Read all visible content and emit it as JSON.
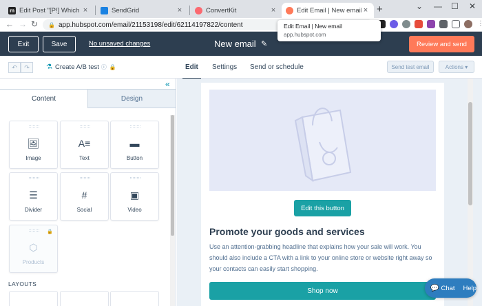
{
  "browser": {
    "tabs": [
      {
        "label": "Edit Post \"[P!] Which Email Ma",
        "favicon_color": "#222222",
        "favicon_glyph": "m"
      },
      {
        "label": "SendGrid",
        "favicon_color": "#1a82e2",
        "favicon_glyph": ""
      },
      {
        "label": "ConvertKit",
        "favicon_color": "#fb6970",
        "favicon_glyph": ""
      },
      {
        "label": "Edit Email | New email",
        "favicon_color": "#ff7a59",
        "favicon_glyph": ""
      }
    ],
    "url": "app.hubspot.com/email/21153198/edit/62114197822/content",
    "tooltip": {
      "title": "Edit Email | New email",
      "domain": "app.hubspot.com"
    },
    "new_tab_glyph": "+",
    "close_glyph": "×",
    "window_controls": [
      "⌄",
      "—",
      "☐",
      "✕"
    ]
  },
  "header": {
    "exit_label": "Exit",
    "save_label": "Save",
    "unsaved_label": "No unsaved changes",
    "email_title": "New email",
    "review_label": "Review and send"
  },
  "subheader": {
    "undo_glyph": "↶",
    "redo_glyph": "↷",
    "ab_test_label": "Create A/B test",
    "tabs": [
      "Edit",
      "Settings",
      "Send or schedule"
    ],
    "send_test_label": "Send test email",
    "actions_label": "Actions ▾"
  },
  "leftpanel": {
    "collapse_glyph": "«",
    "tabs": [
      "Content",
      "Design"
    ],
    "modules": [
      {
        "label": "Image",
        "icon": "image-icon",
        "glyph": "🖼"
      },
      {
        "label": "Text",
        "icon": "text-icon",
        "glyph": "A≡"
      },
      {
        "label": "Button",
        "icon": "button-icon",
        "glyph": "▬"
      },
      {
        "label": "Divider",
        "icon": "divider-icon",
        "glyph": "☰"
      },
      {
        "label": "Social",
        "icon": "social-icon",
        "glyph": "#"
      },
      {
        "label": "Video",
        "icon": "video-icon",
        "glyph": "▣"
      },
      {
        "label": "Products",
        "icon": "products-icon",
        "glyph": "⬡"
      }
    ],
    "layouts_heading": "LAYOUTS"
  },
  "email": {
    "edit_button_label": "Edit this button",
    "promo_title": "Promote your goods and services",
    "promo_body": "Use an attention-grabbing headline that explains how your sale will work. You should also include a CTA with a link to your online store or website right away so your contacts can easily start shopping.",
    "shop_button_label": "Shop now"
  },
  "chat": {
    "chat_label": "Chat",
    "help_label": "Help"
  },
  "colors": {
    "hubspot_header": "#2d3e50",
    "review_orange": "#ff7a59",
    "teal_button": "#1aa1a5",
    "chat_blue": "#2e7dbf"
  }
}
